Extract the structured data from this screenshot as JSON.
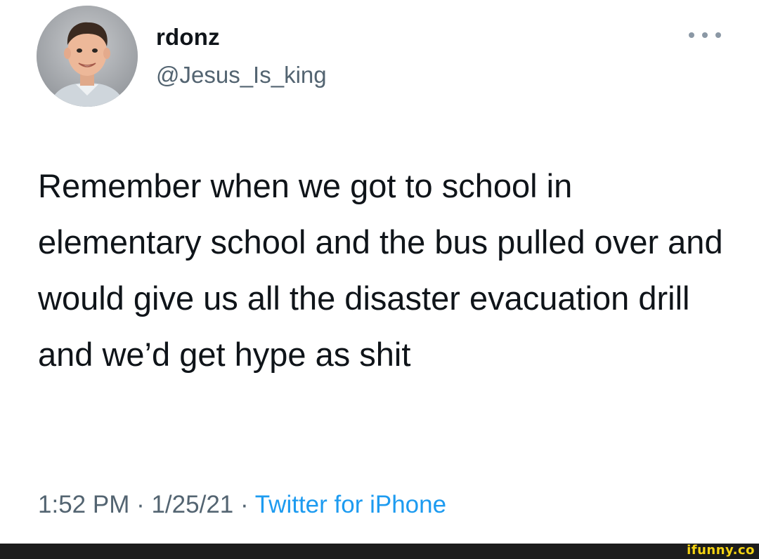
{
  "tweet": {
    "display_name": "rdonz",
    "handle": "@Jesus_Is_king",
    "text": "Remember when we got to school in elementary school and the bus pulled over and would give us all the disaster evacuation drill and we’d get hype as shit",
    "time": "1:52 PM",
    "separator_1": " · ",
    "date": "1/25/21",
    "separator_2": " · ",
    "source": "Twitter for iPhone"
  },
  "icons": {
    "more": "more-options-icon",
    "avatar": "profile-photo"
  },
  "watermark": {
    "text": "ifunny.co"
  },
  "colors": {
    "text_primary": "#0f1419",
    "text_secondary": "#536471",
    "link": "#1d9bf0",
    "footer_bg": "#1c1c1c",
    "watermark": "#f5d312"
  }
}
